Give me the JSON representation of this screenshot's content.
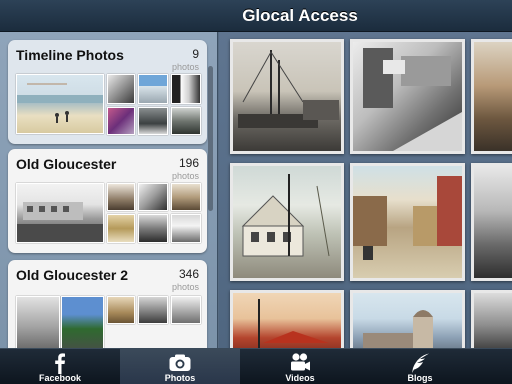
{
  "header": {
    "title": "Glocal Access"
  },
  "albums": [
    {
      "title": "Timeline Photos",
      "count": "9",
      "unit": "photos"
    },
    {
      "title": "Old Gloucester",
      "count": "196",
      "unit": "photos"
    },
    {
      "title": "Old Gloucester 2",
      "count": "346",
      "unit": "photos"
    }
  ],
  "tabs": [
    {
      "label": "Facebook",
      "icon": "facebook-icon"
    },
    {
      "label": "Photos",
      "icon": "camera-icon"
    },
    {
      "label": "Videos",
      "icon": "video-camera-icon"
    },
    {
      "label": "Blogs",
      "icon": "quill-icon"
    }
  ],
  "colors": {
    "header": "#1f3346",
    "panel": "#8599af",
    "tabbar": "#111b25",
    "active_tab": "#33414f"
  }
}
